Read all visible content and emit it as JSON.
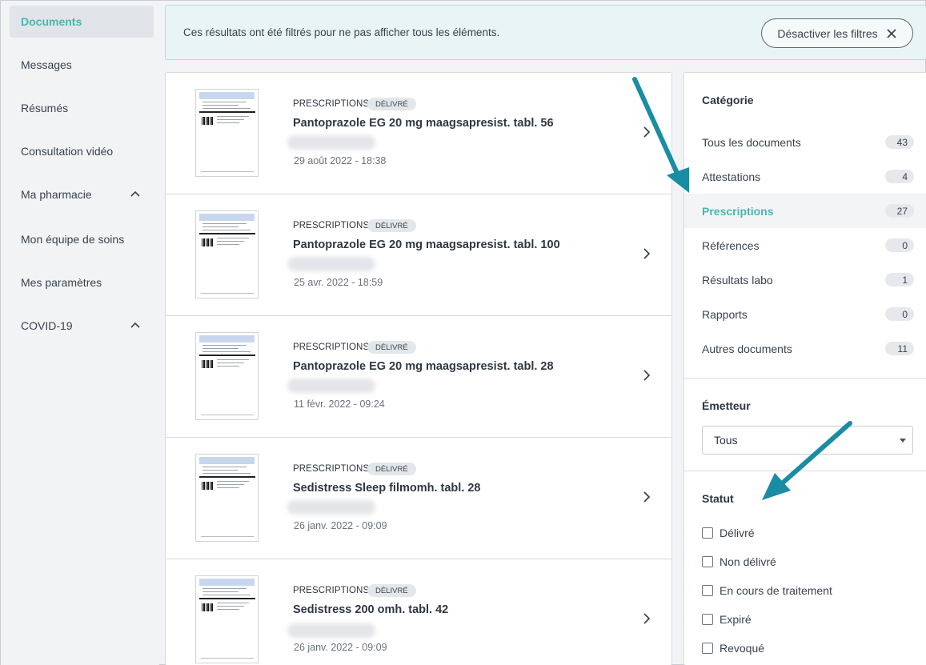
{
  "sidebar": {
    "items": [
      {
        "label": "Documents"
      },
      {
        "label": "Messages"
      },
      {
        "label": "Résumés"
      },
      {
        "label": "Consultation vidéo"
      },
      {
        "label": "Ma pharmacie"
      },
      {
        "label": "Mon équipe de soins"
      },
      {
        "label": "Mes paramètres"
      },
      {
        "label": "COVID-19"
      }
    ],
    "active": "Documents",
    "accent_color": "#4bb5b0"
  },
  "banner": {
    "text": "Ces résultats ont été filtrés pour ne pas afficher tous les éléments.",
    "button_label": "Désactiver les filtres"
  },
  "documents": [
    {
      "category": "PRESCRIPTIONS",
      "status": "DÉLIVRÉ",
      "title": "Pantoprazole EG 20 mg maagsapresist. tabl. 56",
      "date": "29 août 2022 - 18:38"
    },
    {
      "category": "PRESCRIPTIONS",
      "status": "DÉLIVRÉ",
      "title": "Pantoprazole EG 20 mg maagsapresist. tabl. 100",
      "date": "25 avr. 2022 - 18:59"
    },
    {
      "category": "PRESCRIPTIONS",
      "status": "DÉLIVRÉ",
      "title": "Pantoprazole EG 20 mg maagsapresist. tabl. 28",
      "date": "11 févr. 2022 - 09:24"
    },
    {
      "category": "PRESCRIPTIONS",
      "status": "DÉLIVRÉ",
      "title": "Sedistress Sleep filmomh. tabl. 28",
      "date": "26 janv. 2022 - 09:09"
    },
    {
      "category": "PRESCRIPTIONS",
      "status": "DÉLIVRÉ",
      "title": "Sedistress 200 omh. tabl. 42",
      "date": "26 janv. 2022 - 09:09"
    }
  ],
  "filters": {
    "category_heading": "Catégorie",
    "categories": [
      {
        "label": "Tous les documents",
        "count": "43"
      },
      {
        "label": "Attestations",
        "count": "4"
      },
      {
        "label": "Prescriptions",
        "count": "27"
      },
      {
        "label": "Références",
        "count": "0"
      },
      {
        "label": "Résultats labo",
        "count": "1"
      },
      {
        "label": "Rapports",
        "count": "0"
      },
      {
        "label": "Autres documents",
        "count": "11"
      }
    ],
    "selected_category": "Prescriptions",
    "issuer_heading": "Émetteur",
    "issuer_value": "Tous",
    "status_heading": "Statut",
    "statuses": [
      {
        "label": "Délivré",
        "checked": false
      },
      {
        "label": "Non délivré",
        "checked": false
      },
      {
        "label": "En cours de traitement",
        "checked": false
      },
      {
        "label": "Expiré",
        "checked": false
      },
      {
        "label": "Revoqué",
        "checked": false
      }
    ]
  },
  "annotation_color": "#1a8ca3"
}
